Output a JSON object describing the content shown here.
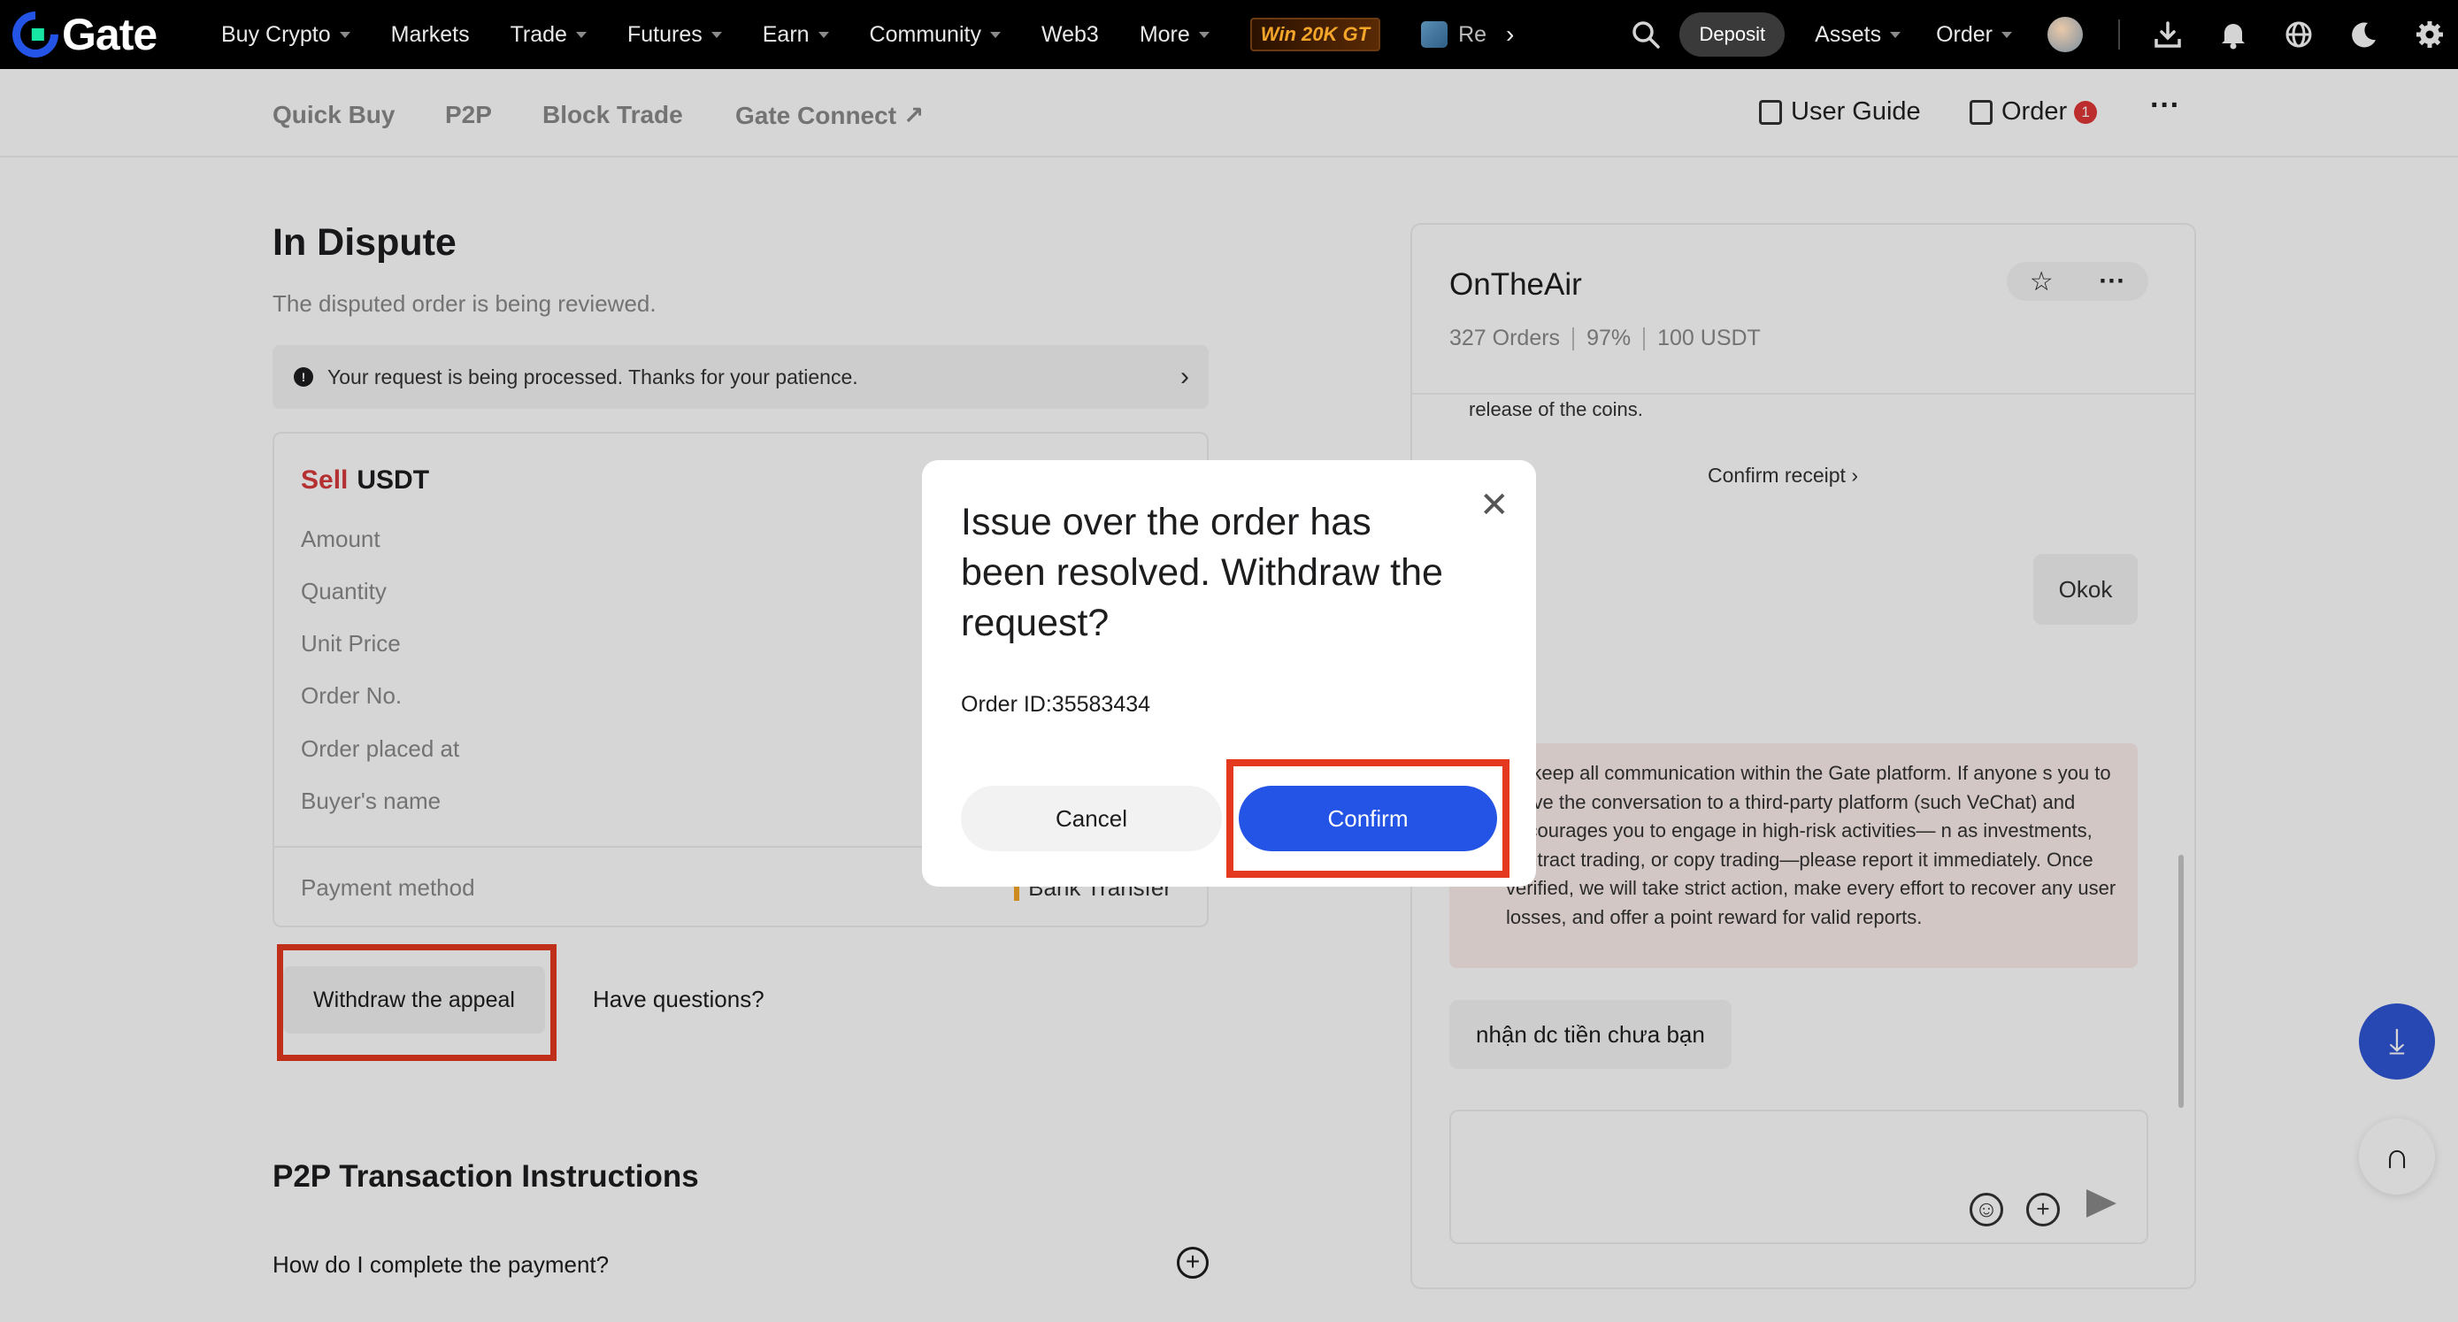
{
  "topnav": {
    "logo": "Gate",
    "items": [
      {
        "label": "Buy Crypto",
        "caret": true
      },
      {
        "label": "Markets",
        "caret": false
      },
      {
        "label": "Trade",
        "caret": true
      },
      {
        "label": "Futures",
        "caret": true
      },
      {
        "label": "Earn",
        "caret": true
      },
      {
        "label": "Community",
        "caret": true
      },
      {
        "label": "Web3",
        "caret": false
      },
      {
        "label": "More",
        "caret": true
      }
    ],
    "promo": "Win 20K GT",
    "re_label": "Re",
    "deposit": "Deposit",
    "assets": "Assets",
    "order": "Order",
    "icons": [
      "search-icon",
      "download-icon",
      "bell-icon",
      "globe-icon",
      "moon-icon",
      "gear-icon"
    ]
  },
  "subnav": {
    "tabs": [
      "Quick Buy",
      "P2P",
      "Block Trade",
      "Gate Connect ↗"
    ],
    "user_guide": "User Guide",
    "order": "Order",
    "order_badge": "1",
    "more": "···"
  },
  "main": {
    "title": "In Dispute",
    "subtitle": "The disputed order is being reviewed.",
    "notice": "Your request is being processed. Thanks for your patience.",
    "order_card": {
      "side": "Sell",
      "asset": "USDT",
      "labels": [
        "Amount",
        "Quantity",
        "Unit Price",
        "Order No.",
        "Order placed at",
        "Buyer's name"
      ],
      "payment_label": "Payment method",
      "payment_value": "Bank Transfer"
    },
    "withdraw_button": "Withdraw the appeal",
    "questions_link": "Have questions?",
    "p2p_title": "P2P Transaction Instructions",
    "faq": "How do I complete the payment?"
  },
  "chat": {
    "merchant": "OnTheAir",
    "stats": [
      "327 Orders",
      "97%",
      "100 USDT"
    ],
    "release_text": "release of the coins.",
    "confirm_receipt": "Confirm receipt",
    "okok": "Okok",
    "warning": "se keep all communication within the Gate platform. If anyone s you to move the conversation to a third-party platform (such VeChat) and encourages you to engage in high-risk activities— n as investments, contract trading, or copy trading—please report it immediately. Once verified, we will take strict action, make every effort to recover any user losses, and offer a point reward for valid reports.",
    "message": "nhận dc tiền chưa bạn"
  },
  "modal": {
    "title": "Issue over the order has been resolved. Withdraw the request?",
    "order_id": "Order ID:35583434",
    "cancel": "Cancel",
    "confirm": "Confirm"
  },
  "colors": {
    "accent": "#2354e6",
    "sell": "#d83b3b",
    "highlight": "#e5391f"
  }
}
